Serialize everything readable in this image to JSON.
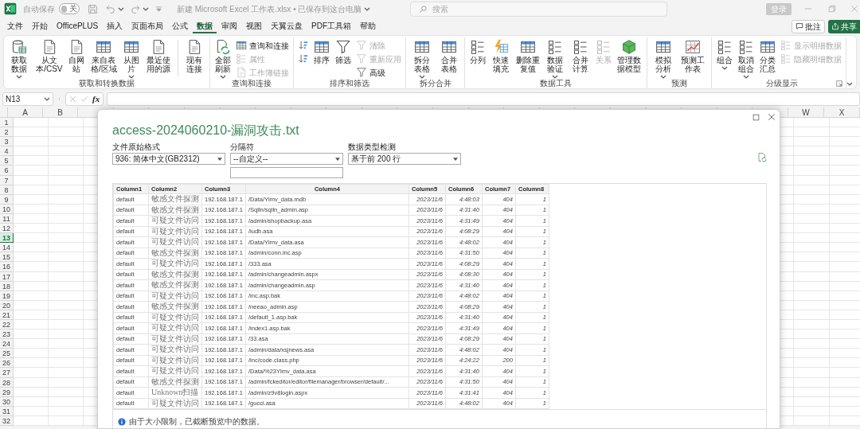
{
  "title_bar": {
    "autosave_label": "自动保存",
    "autosave_toggle": {
      "on": false,
      "label": "关"
    },
    "file_title": "新建 Microsoft Excel 工作表.xlsx • 已保存到这台电脑",
    "search_placeholder": "搜索",
    "sign_in_button": "登录"
  },
  "menu_tabs": [
    {
      "label": "文件",
      "selected": false
    },
    {
      "label": "开始",
      "selected": false
    },
    {
      "label": "OfficePLUS",
      "selected": false
    },
    {
      "label": "插入",
      "selected": false
    },
    {
      "label": "页面布局",
      "selected": false
    },
    {
      "label": "公式",
      "selected": false
    },
    {
      "label": "数据",
      "selected": true
    },
    {
      "label": "审阅",
      "selected": false
    },
    {
      "label": "视图",
      "selected": false
    },
    {
      "label": "天翼云盘",
      "selected": false
    },
    {
      "label": "PDF工具箱",
      "selected": false
    },
    {
      "label": "帮助",
      "selected": false
    }
  ],
  "comments_button": "批注",
  "share_button": "共享",
  "ribbon_groups": [
    {
      "label": "获取和转换数据",
      "items": [
        {
          "kind": "large",
          "label": "获取数据",
          "dropdown": true,
          "disabled": false
        },
        {
          "kind": "large",
          "label": "从文本/CSV",
          "dropdown": false,
          "disabled": false
        },
        {
          "kind": "large",
          "label": "自网站",
          "dropdown": false,
          "disabled": false
        },
        {
          "kind": "large",
          "label": "来自表格/区域",
          "dropdown": false,
          "disabled": false
        },
        {
          "kind": "large",
          "label": "从图片",
          "dropdown": true,
          "disabled": false
        },
        {
          "kind": "large",
          "label": "最近使用的源",
          "dropdown": false,
          "disabled": false
        },
        {
          "kind": "separator"
        },
        {
          "kind": "large",
          "label": "现有连接",
          "dropdown": false,
          "disabled": false
        }
      ]
    },
    {
      "label": "查询和连接",
      "items": [
        {
          "kind": "large",
          "label": "全部刷新",
          "dropdown": true,
          "disabled": false
        },
        {
          "kind": "stack",
          "items": [
            {
              "label": "查询和连接",
              "disabled": false
            },
            {
              "label": "属性",
              "disabled": true
            },
            {
              "label": "工作簿链接",
              "disabled": true
            }
          ]
        }
      ]
    },
    {
      "label": "排序和筛选",
      "items": [
        {
          "kind": "stack",
          "items": [
            {
              "disabled": false
            },
            {
              "disabled": false
            }
          ]
        },
        {
          "kind": "large",
          "label": "排序",
          "dropdown": false,
          "disabled": false
        },
        {
          "kind": "large",
          "label": "筛选",
          "dropdown": false,
          "disabled": false
        },
        {
          "kind": "stack",
          "items": [
            {
              "label": "清除",
              "disabled": true
            },
            {
              "label": "重新应用",
              "disabled": true
            },
            {
              "label": "高级",
              "disabled": false
            }
          ]
        }
      ]
    },
    {
      "label": "拆分合并",
      "items": [
        {
          "kind": "large",
          "label": "拆分表格",
          "dropdown": true,
          "disabled": false
        },
        {
          "kind": "large",
          "label": "合并表格",
          "dropdown": false,
          "disabled": false
        }
      ]
    },
    {
      "label": "数据工具",
      "items": [
        {
          "kind": "large",
          "label": "分列",
          "dropdown": false,
          "disabled": false
        },
        {
          "kind": "large",
          "label": "快速填充",
          "dropdown": false,
          "disabled": false
        },
        {
          "kind": "large",
          "label": "删除重复值",
          "dropdown": false,
          "disabled": false
        },
        {
          "kind": "large",
          "label": "数据验证",
          "dropdown": true,
          "disabled": false
        },
        {
          "kind": "large",
          "label": "合并计算",
          "dropdown": false,
          "disabled": false
        },
        {
          "kind": "large",
          "label": "关系",
          "dropdown": false,
          "disabled": true
        },
        {
          "kind": "large",
          "label": "管理数据模型",
          "dropdown": false,
          "disabled": false
        }
      ]
    },
    {
      "label": "预测",
      "items": [
        {
          "kind": "large",
          "label": "模拟分析",
          "dropdown": true,
          "disabled": false
        },
        {
          "kind": "large",
          "label": "预测工作表",
          "dropdown": false,
          "disabled": false
        }
      ]
    },
    {
      "label": "分级显示",
      "launcher": true,
      "items": [
        {
          "kind": "large",
          "label": "组合",
          "dropdown": true,
          "disabled": false
        },
        {
          "kind": "large",
          "label": "取消组合",
          "dropdown": true,
          "disabled": false
        },
        {
          "kind": "large",
          "label": "分类汇总",
          "dropdown": false,
          "disabled": false
        },
        {
          "kind": "stack",
          "items": [
            {
              "label": "显示明细数据",
              "disabled": true
            },
            {
              "label": "隐藏明细数据",
              "disabled": true
            }
          ]
        }
      ]
    }
  ],
  "formula_bar": {
    "name_box": "N13",
    "function_label": "fx"
  },
  "sheet": {
    "columns": [
      "A",
      "B",
      "W",
      "X"
    ],
    "rows": [
      {
        "label": "1",
        "selected": false
      },
      {
        "label": "2",
        "selected": false
      },
      {
        "label": "3",
        "selected": false
      },
      {
        "label": "4",
        "selected": false
      },
      {
        "label": "5",
        "selected": false
      },
      {
        "label": "6",
        "selected": false
      },
      {
        "label": "7",
        "selected": false
      },
      {
        "label": "8",
        "selected": false
      },
      {
        "label": "9",
        "selected": false
      },
      {
        "label": "10",
        "selected": false
      },
      {
        "label": "11",
        "selected": false
      },
      {
        "label": "12",
        "selected": false
      },
      {
        "label": "13",
        "selected": true
      },
      {
        "label": "14",
        "selected": false
      },
      {
        "label": "15",
        "selected": false
      },
      {
        "label": "16",
        "selected": false
      },
      {
        "label": "17",
        "selected": false
      },
      {
        "label": "18",
        "selected": false
      },
      {
        "label": "19",
        "selected": false
      },
      {
        "label": "20",
        "selected": false
      },
      {
        "label": "21",
        "selected": false
      },
      {
        "label": "22",
        "selected": false
      },
      {
        "label": "23",
        "selected": false
      },
      {
        "label": "24",
        "selected": false
      },
      {
        "label": "25",
        "selected": false
      },
      {
        "label": "26",
        "selected": false
      },
      {
        "label": "27",
        "selected": false
      },
      {
        "label": "28",
        "selected": false
      },
      {
        "label": "29",
        "selected": false
      },
      {
        "label": "30",
        "selected": false
      },
      {
        "label": "31",
        "selected": false
      },
      {
        "label": "32",
        "selected": false
      }
    ]
  },
  "dialog": {
    "title": "access-2024060210-漏洞攻击.txt",
    "file_origin": {
      "label": "文件原始格式",
      "value": "936: 简体中文(GB2312)"
    },
    "delimiter": {
      "label": "分隔符",
      "value": "--自定义--"
    },
    "detection": {
      "label": "数据类型检测",
      "value": "基于前 200 行"
    },
    "table": {
      "columns": [
        "Column1",
        "Column2",
        "Column3",
        "Column4",
        "Column5",
        "Column6",
        "Column7",
        "Column8"
      ],
      "rows": [
        [
          "default",
          "敏感文件探测",
          "192.168.187.1",
          "/Data/Ylmv_data.mdb",
          "2023/11/6",
          "4:48:03",
          "404",
          "1"
        ],
        [
          "default",
          "敏感文件探测",
          "192.168.187.1",
          "/Sqlln/sqlln_admin.asp",
          "2023/11/6",
          "4:31:40",
          "404",
          "1"
        ],
        [
          "default",
          "可疑文件访问",
          "192.168.187.1",
          "/admin/shopbackup.asa",
          "2023/11/6",
          "4:31:49",
          "404",
          "1"
        ],
        [
          "default",
          "可疑文件访问",
          "192.168.187.1",
          "/iudb.asa",
          "2023/11/6",
          "4:08:29",
          "404",
          "1"
        ],
        [
          "default",
          "可疑文件访问",
          "192.168.187.1",
          "/Data/Ylmv_data.asa",
          "2023/11/6",
          "4:48:02",
          "404",
          "1"
        ],
        [
          "default",
          "敏感文件探测",
          "192.168.187.1",
          "/admin/conn.inc.asp",
          "2023/11/6",
          "4:31:50",
          "404",
          "1"
        ],
        [
          "default",
          "可疑文件访问",
          "192.168.187.1",
          "/333.asa",
          "2023/11/6",
          "4:08:29",
          "404",
          "1"
        ],
        [
          "default",
          "敏感文件探测",
          "192.168.187.1",
          "/admin/changeadmin.aspx",
          "2023/11/6",
          "4:08:30",
          "404",
          "1"
        ],
        [
          "default",
          "敏感文件探测",
          "192.168.187.1",
          "/admin/changeadmin.asp",
          "2023/11/6",
          "4:31:40",
          "404",
          "1"
        ],
        [
          "default",
          "可疑文件访问",
          "192.168.187.1",
          "/inc.asp.bak",
          "2023/11/6",
          "4:48:02",
          "404",
          "1"
        ],
        [
          "default",
          "敏感文件探测",
          "192.168.187.1",
          "/neeao_admin.asp",
          "2023/11/6",
          "4:08:29",
          "404",
          "1"
        ],
        [
          "default",
          "可疑文件访问",
          "192.168.187.1",
          "/default_1.asp.bak",
          "2023/11/6",
          "4:31:40",
          "404",
          "1"
        ],
        [
          "default",
          "可疑文件访问",
          "192.168.187.1",
          "/index1.asp.bak",
          "2023/11/6",
          "4:31:49",
          "404",
          "1"
        ],
        [
          "default",
          "可疑文件访问",
          "192.168.187.1",
          "/33.asa",
          "2023/11/6",
          "4:08:29",
          "404",
          "1"
        ],
        [
          "default",
          "可疑文件访问",
          "192.168.187.1",
          "/admin/data/xsjnews.asa",
          "2023/11/6",
          "4:48:02",
          "404",
          "1"
        ],
        [
          "default",
          "可疑文件访问",
          "192.168.187.1",
          "/inc/code.class.php",
          "2023/11/6",
          "4:24:22",
          "200",
          "1"
        ],
        [
          "default",
          "可疑文件访问",
          "192.168.187.1",
          "/Data/%23Ylmv_data.asa",
          "2023/11/6",
          "4:31:40",
          "404",
          "1"
        ],
        [
          "default",
          "敏感文件探测",
          "192.168.187.1",
          "/admin/fckeditor/editor/filemanager/browser/default/...",
          "2023/11/6",
          "4:31:50",
          "404",
          "1"
        ],
        [
          "default",
          "Unknown扫描",
          "192.168.187.1",
          "/admin/z9v8login.aspx",
          "2023/11/6",
          "4:31:41",
          "404",
          "1"
        ],
        [
          "default",
          "可疑文件访问",
          "192.168.187.1",
          "/gucci.asa",
          "2023/11/6",
          "4:48:02",
          "404",
          "1"
        ]
      ]
    },
    "notice": "由于大小限制，已截断预览中的数据。"
  }
}
